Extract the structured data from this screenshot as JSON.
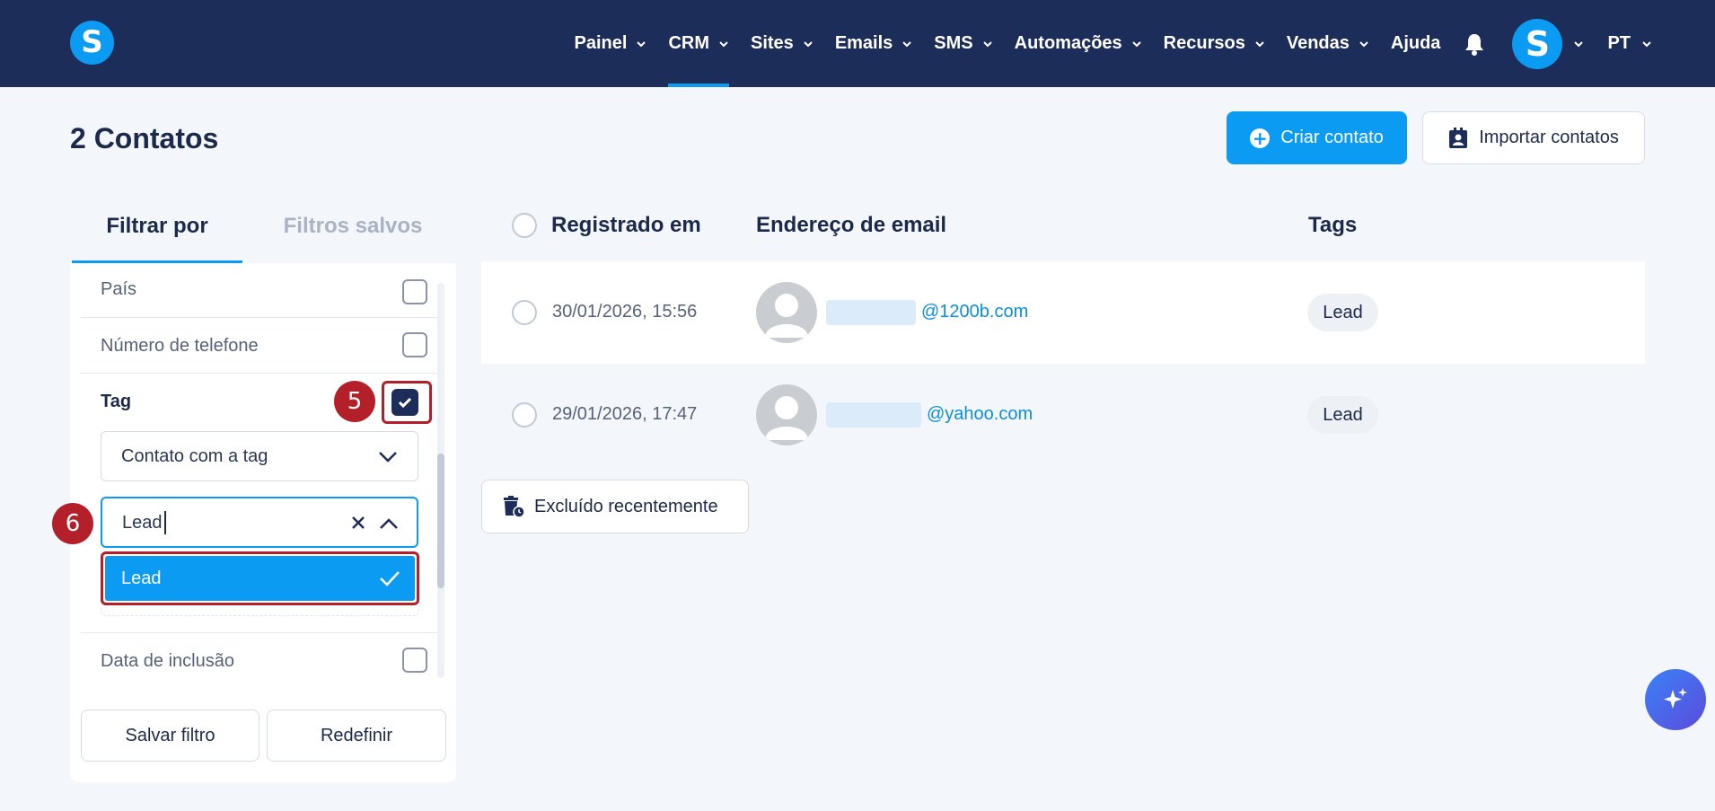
{
  "app": {
    "logo_letter": "S"
  },
  "nav": {
    "items": [
      {
        "label": "Painel",
        "has_menu": true
      },
      {
        "label": "CRM",
        "has_menu": true,
        "active": true
      },
      {
        "label": "Sites",
        "has_menu": true
      },
      {
        "label": "Emails",
        "has_menu": true
      },
      {
        "label": "SMS",
        "has_menu": true
      },
      {
        "label": "Automações",
        "has_menu": true
      },
      {
        "label": "Recursos",
        "has_menu": true
      },
      {
        "label": "Vendas",
        "has_menu": true
      },
      {
        "label": "Ajuda",
        "has_menu": false
      }
    ],
    "avatar_letter": "S",
    "language": "PT"
  },
  "page": {
    "title": "2 Contatos",
    "create_label": "Criar contato",
    "import_label": "Importar contatos"
  },
  "filter": {
    "tab_active": "Filtrar por",
    "tab_inactive": "Filtros salvos",
    "rows": {
      "country": "País",
      "phone": "Número de telefone",
      "date_added": "Data de inclusão"
    },
    "tag": {
      "label": "Tag",
      "checked": true,
      "condition": "Contato com a tag",
      "search_value": "Lead",
      "option": "Lead"
    },
    "save_label": "Salvar filtro",
    "reset_label": "Redefinir"
  },
  "steps": {
    "five": "5",
    "six": "6"
  },
  "table": {
    "headers": {
      "registered": "Registrado em",
      "email": "Endereço de email",
      "tags": "Tags"
    },
    "rows": [
      {
        "date": "30/01/2026, 15:56",
        "email": "@1200b.com",
        "tag": "Lead"
      },
      {
        "date": "29/01/2026, 17:47",
        "email": "@yahoo.com",
        "tag": "Lead"
      }
    ]
  },
  "deleted_label": "Excluído recentemente",
  "colors": {
    "navy": "#1d2d5a",
    "accent": "#0c9bf2",
    "highlight": "#b3202a"
  },
  "icons": [
    "chevron-down-icon",
    "bell-icon",
    "plus-circle-icon",
    "contact-card-icon",
    "check-icon",
    "close-icon",
    "chevron-up-icon",
    "trash-clock-icon",
    "sparkle-icon"
  ]
}
